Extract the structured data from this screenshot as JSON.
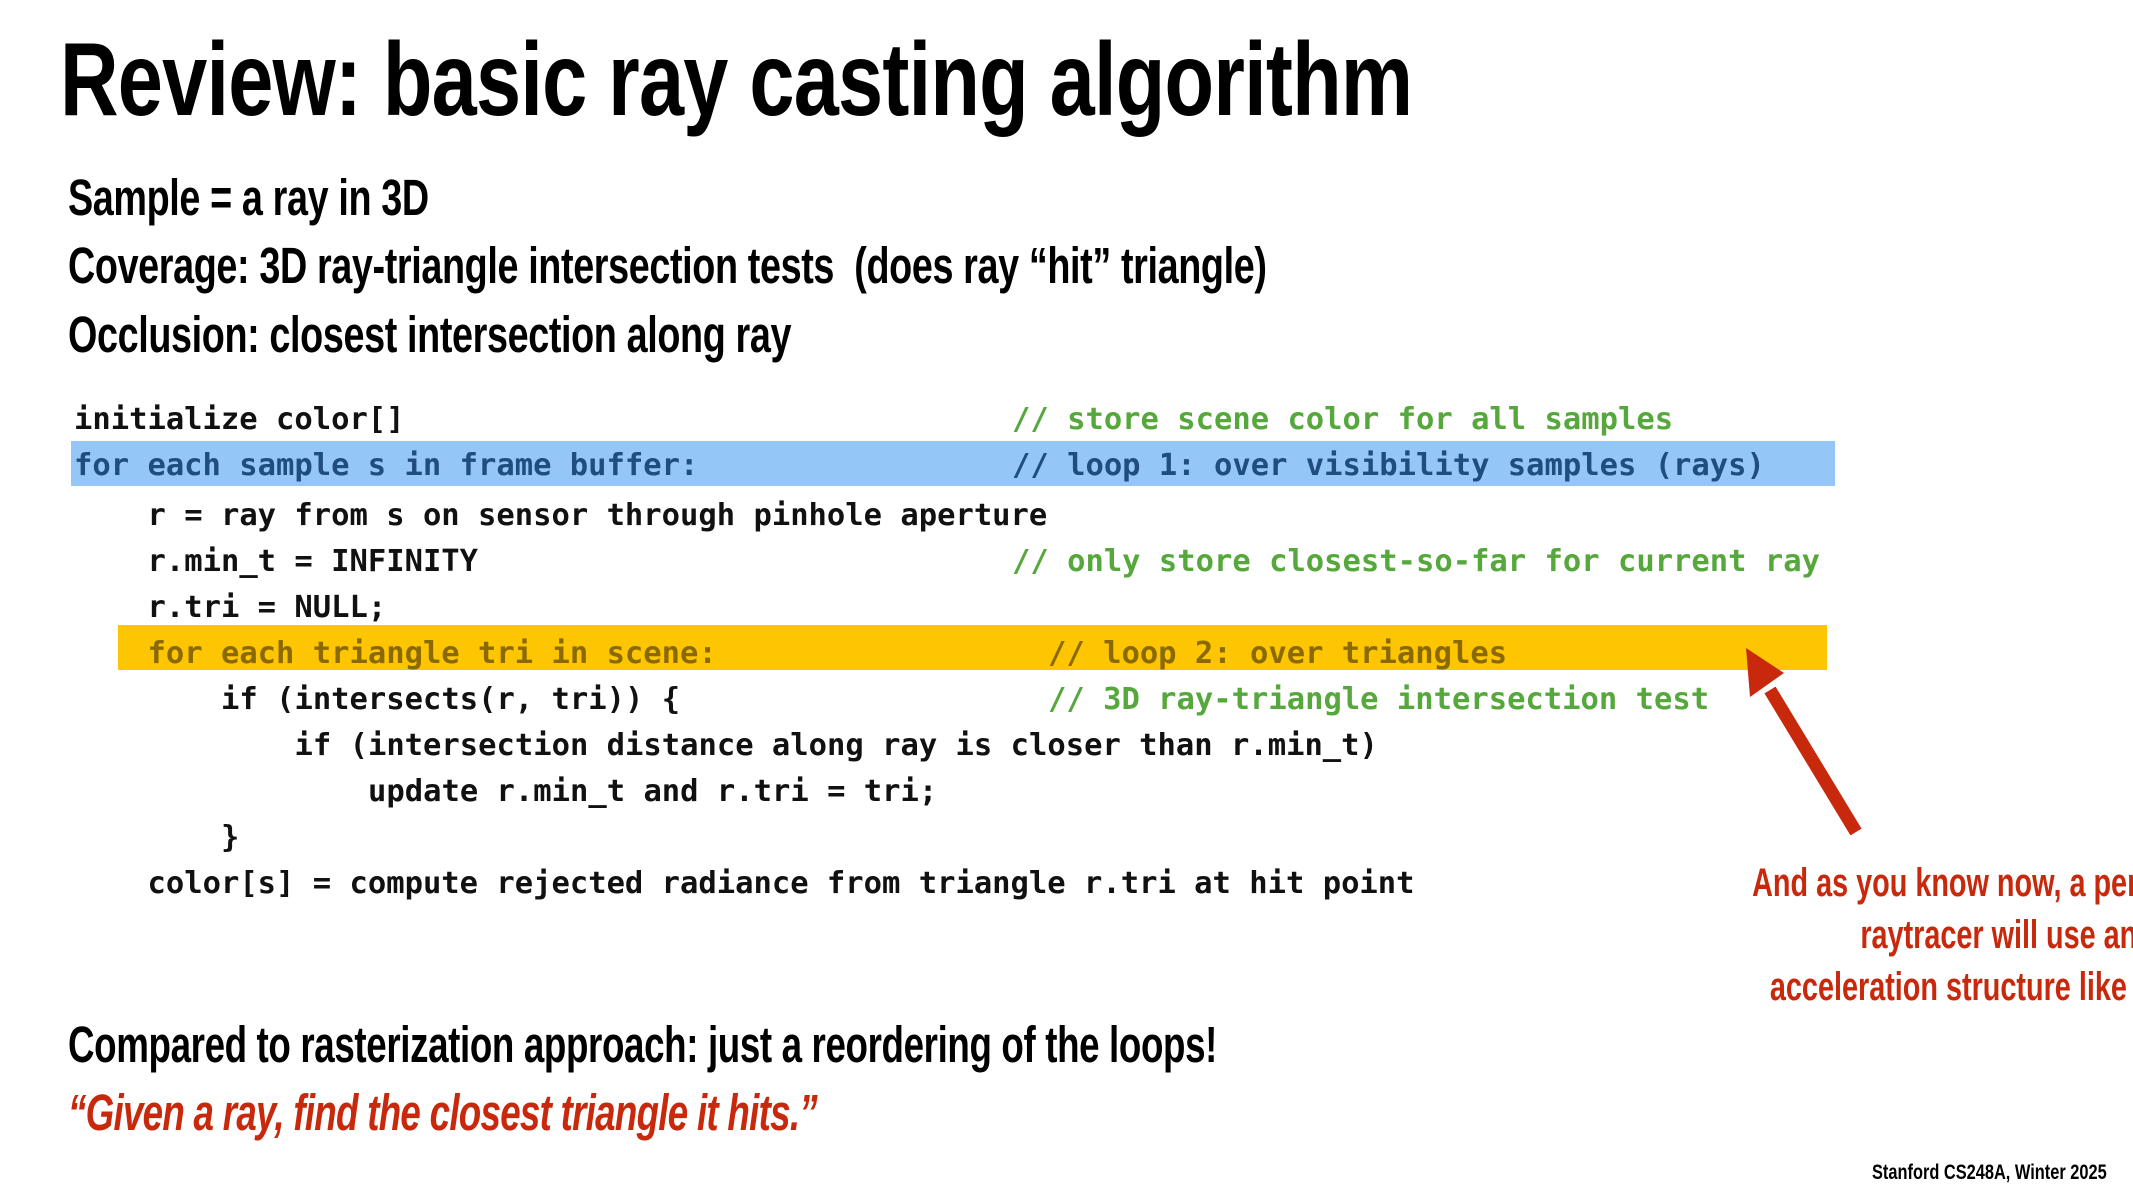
{
  "slide": {
    "title": "Review: basic ray casting algorithm",
    "bullets": [
      "Sample = a ray in 3D",
      "Coverage: 3D ray-triangle intersection tests  (does ray “hit” triangle)",
      "Occlusion: closest intersection along ray"
    ],
    "code": [
      {
        "indent": 0,
        "text": "initialize color[]",
        "comment": "// store scene color for all samples",
        "highlight": "none"
      },
      {
        "indent": 0,
        "text": "for each sample s in frame buffer:",
        "comment": "// loop 1: over visibility samples (rays)",
        "highlight": "blue"
      },
      {
        "indent": 1,
        "text": "r = ray from s on sensor through pinhole aperture",
        "comment": "",
        "highlight": "none"
      },
      {
        "indent": 1,
        "text": "r.min_t = INFINITY",
        "comment": "// only store closest-so-far for current ray",
        "highlight": "none"
      },
      {
        "indent": 1,
        "text": "r.tri = NULL;",
        "comment": "",
        "highlight": "none"
      },
      {
        "indent": 1,
        "text": "for each triangle tri in scene:",
        "comment": "// loop 2: over triangles",
        "highlight": "orange"
      },
      {
        "indent": 2,
        "text": "if (intersects(r, tri)) {",
        "comment": "// 3D ray-triangle intersection test",
        "highlight": "none"
      },
      {
        "indent": 3,
        "text": "if (intersection distance along ray is closer than r.min_t)",
        "comment": "",
        "highlight": "none"
      },
      {
        "indent": 4,
        "text": "update r.min_t and r.tri = tri;",
        "comment": "",
        "highlight": "none"
      },
      {
        "indent": 2,
        "text": "}",
        "comment": "",
        "highlight": "none"
      },
      {
        "indent": 1,
        "text": "color[s] = compute rejected radiance from triangle r.tri at hit point",
        "comment": "",
        "highlight": "none"
      }
    ],
    "annotation": [
      "And as you know now, a performant",
      "raytracer will use an",
      "acceleration structure like a BVH."
    ],
    "comparison": "Compared to rasterization approach: just a reordering of the loops!",
    "quote": "“Given a ray, find the closest triangle it hits.”",
    "footer": "Stanford CS248A, Winter 2025",
    "colors": {
      "loop1_highlight": "#94c6f7",
      "loop2_highlight": "#fdc502",
      "comment": "#56a83c",
      "accent_red": "#c8290c"
    }
  }
}
